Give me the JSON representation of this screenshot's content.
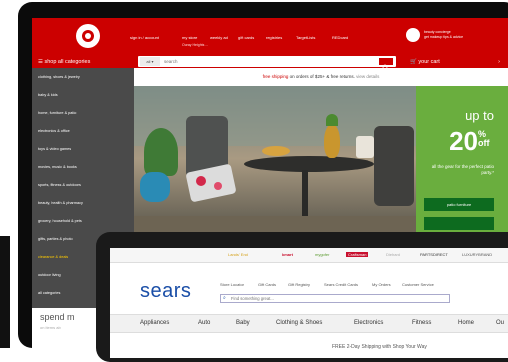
{
  "target": {
    "header": {
      "nav": [
        "sign in / account",
        "my store",
        "weekly ad",
        "gift cards",
        "registries",
        "TargetLists",
        "REDcard"
      ],
      "sub": "Ouray Heights ...",
      "concierge": "beauty concierge",
      "concierge_sub": "get makeup tips & advice"
    },
    "shop_all": "shop all categories",
    "search": {
      "category": "all",
      "placeholder": "search"
    },
    "cart": "your cart",
    "sidebar": [
      "clothing, shoes & jewelry",
      "baby & kids",
      "home, furniture & patio",
      "electronics & office",
      "toys & video games",
      "movies, music & books",
      "sports, fitness & outdoors",
      "beauty, health & pharmacy",
      "grocery, household & pets",
      "gifts, parties & photo",
      "clearance & deals",
      "outdoor living",
      "all categories"
    ],
    "sidebar_footer": {
      "title": "spend m",
      "sub": "on items ab"
    },
    "promo": {
      "free": "free shipping",
      "rest": "on orders of $25+ & free returns.",
      "details": "view details"
    },
    "hero": {
      "up_to": "up to",
      "percent": "20",
      "pct_symbol": "%",
      "off": "off",
      "all_gear": "all the gear for the perfect patio party.*",
      "button1": "patio furniture"
    }
  },
  "sears": {
    "brands": [
      "Lands' End",
      "kmart",
      "mygofer",
      "Craftsman",
      "Diehard",
      "PARTSDIRECT",
      "LUXURYBRAND"
    ],
    "logo": "sears",
    "links": [
      "Store Locator",
      "Gift Cards",
      "Gift Registry",
      "Sears Credit Cards",
      "My Orders",
      "Customer Service"
    ],
    "search_placeholder": "Find something great...",
    "nav": [
      "Appliances",
      "Auto",
      "Baby",
      "Clothing & Shoes",
      "Electronics",
      "Fitness",
      "Home",
      "Ou"
    ],
    "free_shipping": "FREE 2-Day Shipping with Shop Your Way"
  }
}
